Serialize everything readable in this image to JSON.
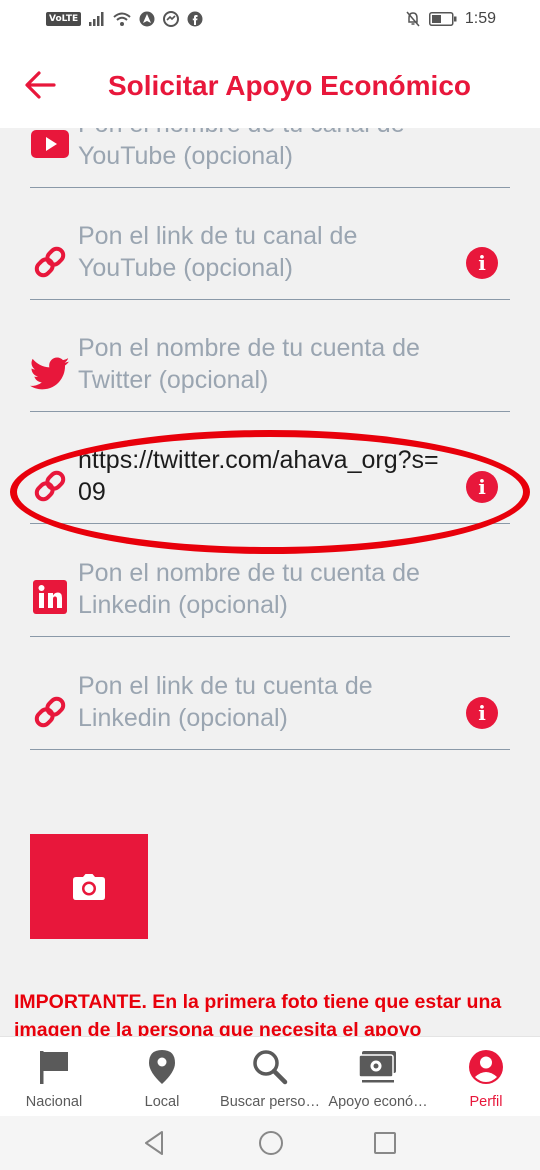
{
  "status_bar": {
    "volte_label": "VoLTE",
    "time": "1:59"
  },
  "header": {
    "title": "Solicitar Apoyo Económico",
    "back_icon": "arrow-left-icon"
  },
  "form": {
    "fields": [
      {
        "icon": "youtube-icon",
        "text": "Pon el nombre de tu canal de YouTube (opcional)",
        "filled": false,
        "info": false
      },
      {
        "icon": "link-icon",
        "text": "Pon el link de tu canal de YouTube (opcional)",
        "filled": false,
        "info": true
      },
      {
        "icon": "twitter-icon",
        "text": "Pon el nombre de tu cuenta de Twitter (opcional)",
        "filled": false,
        "info": false
      },
      {
        "icon": "link-icon",
        "text": "https://twitter.com/ahava_org?s=09",
        "filled": true,
        "info": true
      },
      {
        "icon": "linkedin-icon",
        "text": "Pon el nombre de tu cuenta de Linkedin (opcional)",
        "filled": false,
        "info": false
      },
      {
        "icon": "link-icon",
        "text": "Pon el link de tu cuenta de Linkedin (opcional)",
        "filled": false,
        "info": true
      }
    ],
    "info_glyph": "i",
    "photo_button_icon": "camera-icon",
    "important_text": "IMPORTANTE. En la primera foto tiene que estar una imagen de la persona que necesita el apoyo"
  },
  "bottom_nav": {
    "items": [
      {
        "label": "Nacional",
        "icon": "flag-icon",
        "active": false
      },
      {
        "label": "Local",
        "icon": "location-pin-icon",
        "active": false
      },
      {
        "label": "Buscar perso…",
        "icon": "search-icon",
        "active": false
      },
      {
        "label": "Apoyo econó…",
        "icon": "money-icon",
        "active": false
      },
      {
        "label": "Perfil",
        "icon": "profile-icon",
        "active": true
      }
    ]
  },
  "colors": {
    "accent": "#e8173b",
    "annotation": "#e8000b",
    "placeholder": "#9aa5b1",
    "underline": "#8a99a8",
    "background": "#f1f1f1"
  }
}
